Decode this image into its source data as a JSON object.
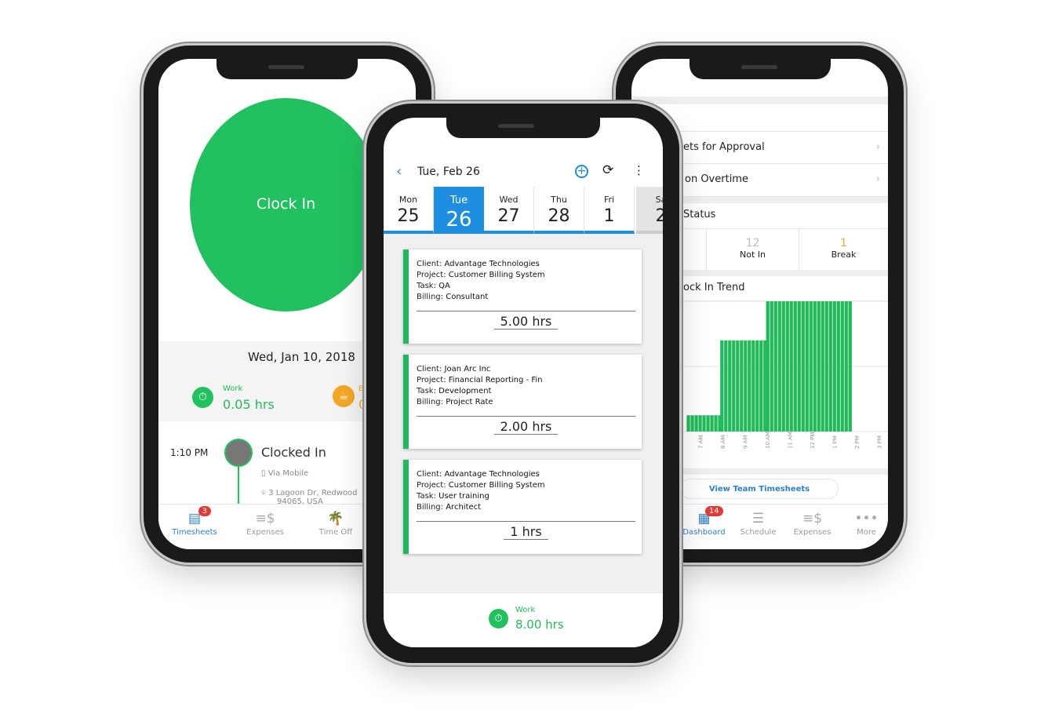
{
  "left_phone": {
    "clock_button": "Clock In",
    "date": "Wed, Jan 10, 2018",
    "work_label": "Work",
    "work_value": "0.05 hrs",
    "break_label": "B",
    "break_value": "0",
    "event_time": "1:10 PM",
    "event_title": "Clocked In",
    "event_source": "Via Mobile",
    "event_address": "3 Lagoon Dr, Redwood",
    "event_address2": "94065, USA",
    "tabs": [
      {
        "label": "Timesheets",
        "icon": "timesheet-icon",
        "badge": "3"
      },
      {
        "label": "Expenses",
        "icon": "expenses-icon"
      },
      {
        "label": "Time Off",
        "icon": "palm-tree-icon"
      }
    ],
    "colors": {
      "green": "#22c160",
      "orange": "#f5a623"
    }
  },
  "middle_phone": {
    "header_title": "Tue, Feb 26",
    "days": [
      {
        "name": "Mon",
        "num": "25"
      },
      {
        "name": "Tue",
        "num": "26"
      },
      {
        "name": "Wed",
        "num": "27"
      },
      {
        "name": "Thu",
        "num": "28"
      },
      {
        "name": "Fri",
        "num": "1"
      },
      {
        "name": "Sa",
        "num": "2"
      }
    ],
    "selected_day": "Tue",
    "entries": [
      {
        "client": "Advantage Technologies",
        "project": "Customer Billing System",
        "task": "QA",
        "billing": "Consultant",
        "hours": "5.00 hrs"
      },
      {
        "client": "Joan Arc Inc",
        "project": "Financial Reporting - Fin",
        "task": "Development",
        "billing": "Project Rate",
        "hours": "2.00 hrs"
      },
      {
        "client": "Advantage Technologies",
        "project": "Customer Billing System",
        "task": "User training",
        "billing": "Architect",
        "hours": "1 hrs"
      }
    ],
    "labels": {
      "client": "Client: ",
      "project": "Project: ",
      "task": "Task: ",
      "billing": "Billing: "
    },
    "footer_label": "Work",
    "footer_value": "8.00 hrs",
    "accent": "#1e8fe0"
  },
  "right_phone": {
    "rows": [
      "ets for Approval",
      "on Overtime"
    ],
    "status_title": "Status",
    "stats": [
      {
        "value": "12",
        "label": "Not In"
      },
      {
        "value": "1",
        "label": "Break"
      }
    ],
    "trend_title": "ock In Trend",
    "view_button": "View Team Timesheets",
    "tabs": [
      {
        "label": "Dashboard",
        "icon": "grid-icon",
        "badge": "14"
      },
      {
        "label": "Schedule",
        "icon": "schedule-icon"
      },
      {
        "label": "Expenses",
        "icon": "expenses-icon"
      },
      {
        "label": "More",
        "icon": "more-icon"
      }
    ]
  },
  "chart_data": {
    "type": "bar",
    "x_ticks": [
      "7 AM",
      "8 AM",
      "9 AM",
      "10 AM",
      "11 AM",
      "12 PM",
      "1 PM",
      "2 PM",
      "3 PM"
    ],
    "segments": [
      {
        "from_hour": 6.4,
        "to_hour": 7.9,
        "value": 0.25
      },
      {
        "from_hour": 7.9,
        "to_hour": 9.95,
        "value": 1.4
      },
      {
        "from_hour": 9.95,
        "to_hour": 13.7,
        "value": 2.0
      }
    ],
    "ylim": [
      0,
      2
    ],
    "grid": true,
    "color": "#22b95a"
  }
}
